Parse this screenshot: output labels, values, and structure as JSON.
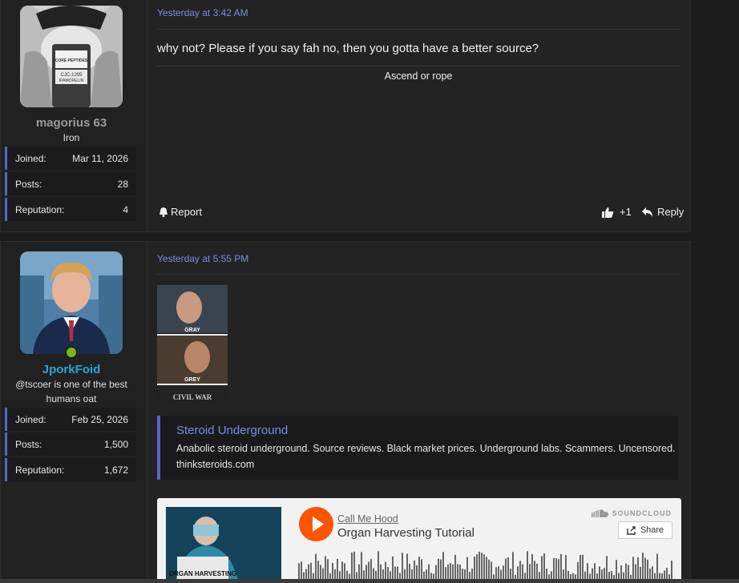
{
  "posts": [
    {
      "username": "magorius 63",
      "user_title": "Iron",
      "stats": [
        {
          "label": "Joined:",
          "value": "Mar 11, 2026"
        },
        {
          "label": "Posts:",
          "value": "28"
        },
        {
          "label": "Reputation:",
          "value": "4"
        }
      ],
      "date": "Yesterday at 3:42 AM",
      "body": "why not? Please if you say fah no, then you gotta have a better source?",
      "signature": "Ascend or rope",
      "actions": {
        "report": "Report",
        "reactions": "+1",
        "reply": "Reply"
      },
      "avatar_text": [
        "CORE PEPTIDES",
        "CJC-1295",
        "IPAMORELIN"
      ]
    },
    {
      "username": "JporkFoid",
      "user_title": "@tscoer is one of the best humans oat",
      "stats": [
        {
          "label": "Joined:",
          "value": "Feb 25, 2026"
        },
        {
          "label": "Posts:",
          "value": "1,500"
        },
        {
          "label": "Reputation:",
          "value": "1,672"
        }
      ],
      "date": "Yesterday at 5:55 PM",
      "meme_labels": [
        "GRAY",
        "GREY",
        "CIVIL WAR"
      ],
      "embed": {
        "title": "Steroid Underground",
        "description": "Anabolic steroid underground. Source reviews. Black market prices. Underground labs. Scammers. Uncensored.",
        "domain": "thinksteroids.com"
      },
      "soundcloud": {
        "artist": "Call Me Hood",
        "track": "Organ Harvesting Tutorial",
        "brand": "SOUNDCLOUD",
        "share": "Share",
        "art_text": "ORGAN HARVESTING"
      }
    }
  ],
  "colors": {
    "accent": "#5865c8",
    "link": "#7b8be6",
    "username_highlight": "#26a9d8",
    "online": "#7cb518",
    "soundcloud": "#ff5500"
  }
}
